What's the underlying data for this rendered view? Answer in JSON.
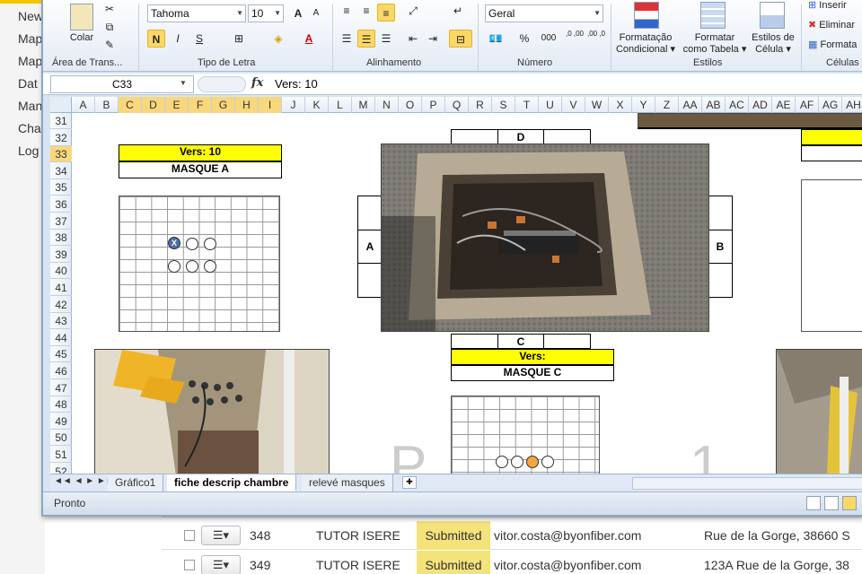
{
  "background_app": {
    "sidebar": [
      "New",
      "Map",
      "Map",
      "Dat",
      "Man",
      "Cha",
      "Log"
    ],
    "rows": [
      {
        "id": "348",
        "name": "TUTOR ISERE",
        "status": "Submitted",
        "email": "vitor.costa@byonfiber.com",
        "address": "Rue de la Gorge, 38660 S",
        "menu": "☰▾"
      },
      {
        "id": "349",
        "name": "TUTOR ISERE",
        "status": "Submitted",
        "email": "vitor.costa@byonfiber.com",
        "address": "123A Rue de la Gorge, 38",
        "menu": "☰▾"
      }
    ]
  },
  "ribbon": {
    "clipboard": {
      "paste_label": "Colar",
      "group_label": "Área de Trans..."
    },
    "font": {
      "name": "Tahoma",
      "size": "10",
      "bold": "N",
      "italic": "I",
      "underline": "S",
      "grow": "A",
      "shrink": "A",
      "color_letter": "A",
      "group_label": "Tipo de Letra"
    },
    "alignment": {
      "group_label": "Alinhamento"
    },
    "number": {
      "format": "Geral",
      "percent": "%",
      "thousands": "000",
      "inc_dec": ",0 ,00",
      "dec_dec": ",00 ,0",
      "group_label": "Número"
    },
    "styles": {
      "conditional": [
        "Formatação",
        "Condicional ▾"
      ],
      "table": [
        "Formatar",
        "como Tabela ▾"
      ],
      "cell_styles": [
        "Estilos de",
        "Célula ▾"
      ],
      "group_label": "Estilos"
    },
    "cells": {
      "insert": "Inserir",
      "delete": "Eliminar",
      "format": "Formata",
      "group_label": "Células"
    }
  },
  "formula_bar": {
    "name_box": "C33",
    "fx": "fx",
    "value": "Vers: 10"
  },
  "columns": [
    "A",
    "B",
    "C",
    "D",
    "E",
    "F",
    "G",
    "H",
    "I",
    "J",
    "K",
    "L",
    "M",
    "N",
    "O",
    "P",
    "Q",
    "R",
    "S",
    "T",
    "U",
    "V",
    "W",
    "X",
    "Y",
    "Z",
    "AA",
    "AB",
    "AC",
    "AD",
    "AE",
    "AF",
    "AG",
    "AH"
  ],
  "highlight_columns": [
    "C",
    "D",
    "E",
    "F",
    "G",
    "H",
    "I"
  ],
  "rows": [
    "31",
    "32",
    "33",
    "34",
    "35",
    "36",
    "37",
    "38",
    "39",
    "40",
    "41",
    "42",
    "43",
    "44",
    "45",
    "46",
    "47",
    "48",
    "49",
    "50",
    "51",
    "52"
  ],
  "highlight_row": "33",
  "sheet": {
    "vers_a": "Vers: 10",
    "masque_a": "MASQUE A",
    "vers_c": "Vers:",
    "masque_c": "MASQUE C",
    "label_d": "D",
    "label_a": "A",
    "label_b": "B",
    "label_c": "C",
    "mark_x": "X",
    "big_left": "P",
    "big_right": "1"
  },
  "tabs": {
    "nav": "◄◄ ◄ ► ►►",
    "items": [
      "Gráfico1",
      "fiche descrip chambre",
      "relevé masques"
    ],
    "active": "fiche descrip chambre"
  },
  "status": {
    "text": "Pronto"
  }
}
